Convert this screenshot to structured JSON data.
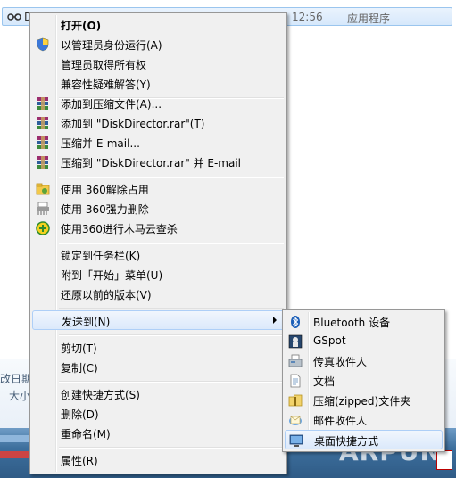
{
  "explorer": {
    "file_name": "D",
    "file_time": "12:56",
    "file_type": "应用程序",
    "details_date": "改日期",
    "details_size": "大小",
    "watermark": "ARPUN"
  },
  "context_menu": {
    "items": [
      {
        "label": "打开(O)"
      },
      {
        "label": "以管理员身份运行(A)"
      },
      {
        "label": "管理员取得所有权"
      },
      {
        "label": "兼容性疑难解答(Y)"
      },
      {
        "label": "添加到压缩文件(A)..."
      },
      {
        "label": "添加到 \"DiskDirector.rar\"(T)"
      },
      {
        "label": "压缩并 E-mail..."
      },
      {
        "label": "压缩到 \"DiskDirector.rar\" 并 E-mail"
      },
      {
        "label": "使用 360解除占用"
      },
      {
        "label": "使用 360强力删除"
      },
      {
        "label": "使用360进行木马云查杀"
      },
      {
        "label": "锁定到任务栏(K)"
      },
      {
        "label": "附到「开始」菜单(U)"
      },
      {
        "label": "还原以前的版本(V)"
      },
      {
        "label": "发送到(N)"
      },
      {
        "label": "剪切(T)"
      },
      {
        "label": "复制(C)"
      },
      {
        "label": "创建快捷方式(S)"
      },
      {
        "label": "删除(D)"
      },
      {
        "label": "重命名(M)"
      },
      {
        "label": "属性(R)"
      }
    ]
  },
  "send_to_menu": {
    "items": [
      {
        "label": "Bluetooth 设备"
      },
      {
        "label": "GSpot"
      },
      {
        "label": "传真收件人"
      },
      {
        "label": "文档"
      },
      {
        "label": "压缩(zipped)文件夹"
      },
      {
        "label": "邮件收件人"
      },
      {
        "label": "桌面快捷方式"
      }
    ]
  },
  "colors": {
    "menu_bg": "#f0f0f0",
    "highlight_border": "#aecff7",
    "taskbar": "#3d6f9d"
  }
}
